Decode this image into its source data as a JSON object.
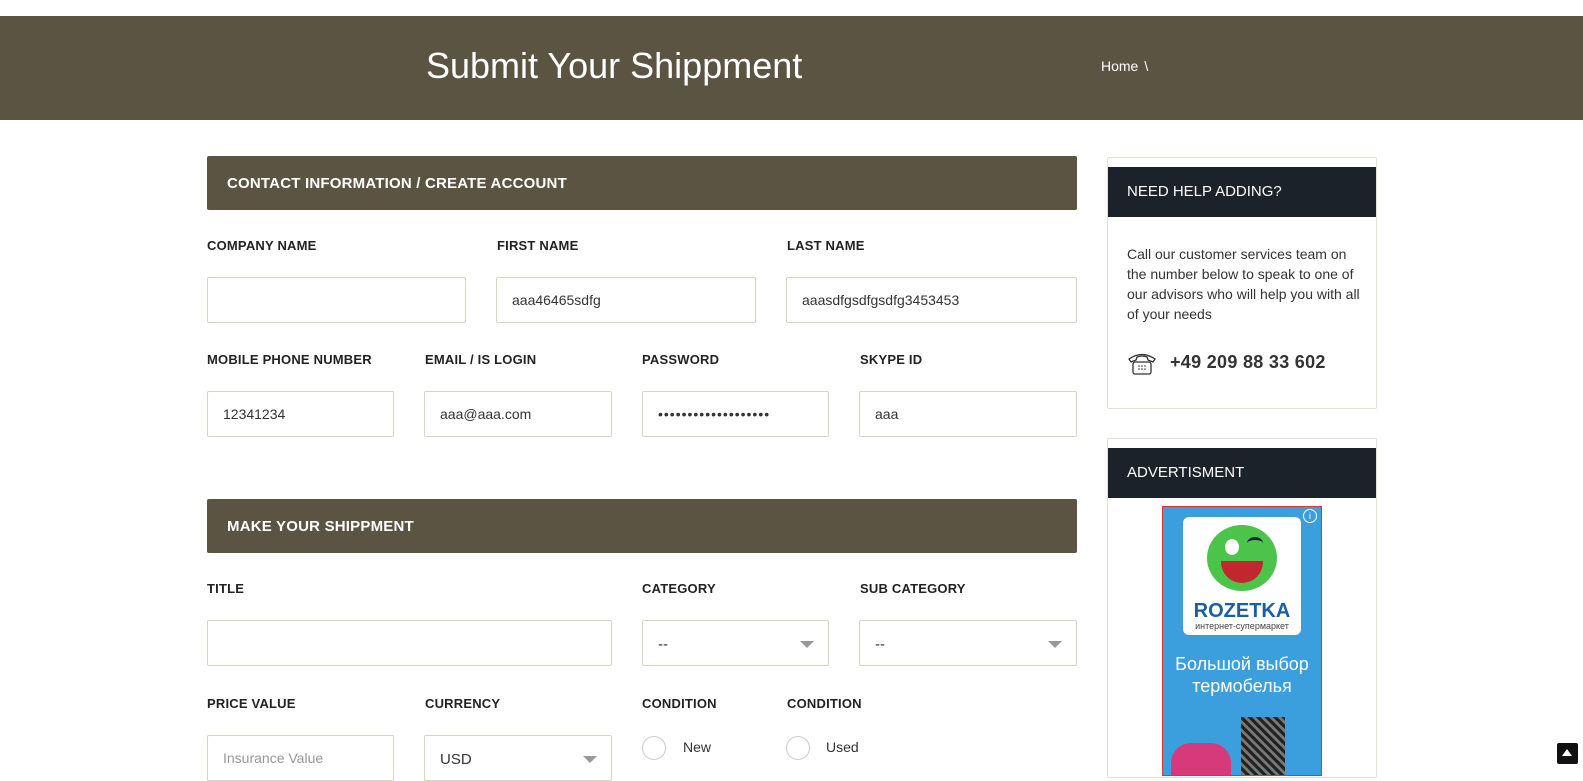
{
  "header": {
    "title": "Submit Your Shippment",
    "breadcrumb_home": "Home",
    "breadcrumb_sep": "\\"
  },
  "contact": {
    "section_title": "CONTACT INFORMATION / CREATE ACCOUNT",
    "company_label": "COMPANY NAME",
    "company_value": "",
    "first_label": "FIRST NAME",
    "first_value": "aaa46465sdfg",
    "last_label": "LAST NAME",
    "last_value": "aaasdfgsdfgsdfg3453453",
    "mobile_label": "MOBILE PHONE NUMBER",
    "mobile_value": "12341234",
    "email_label": "EMAIL / IS LOGIN",
    "email_value": "aaa@aaa.com",
    "password_label": "PASSWORD",
    "password_value": "aaaaaaaaaaaaaaaaaaa",
    "skype_label": "SKYPE ID",
    "skype_value": "aaa"
  },
  "shipment": {
    "section_title": "MAKE YOUR SHIPPMENT",
    "title_label": "TITLE",
    "title_value": "",
    "category_label": "CATEGORY",
    "category_value": "--",
    "subcategory_label": "SUB CATEGORY",
    "subcategory_value": "--",
    "price_label": "PRICE VALUE",
    "price_placeholder": "Insurance Value",
    "currency_label": "CURRENCY",
    "currency_value": "USD",
    "condition_label": "CONDITION",
    "condition_new": "New",
    "condition_label2": "CONDITION",
    "condition_used": "Used"
  },
  "sidebar": {
    "help_title": "NEED HELP ADDING?",
    "help_text": "Call our customer services team on the number below to speak to one of our advisors who will help you with all of your needs",
    "phone": "+49 209 88 33 602",
    "ad_title": "ADVERTISMENT",
    "ad_brand": "ROZETKA",
    "ad_tagline": "интернет-супермаркет",
    "ad_text": "Большой выбор термобелья",
    "ad_info": "i"
  },
  "colors": {
    "brand_bar": "#5c5442",
    "panel_head": "#1b2229"
  }
}
